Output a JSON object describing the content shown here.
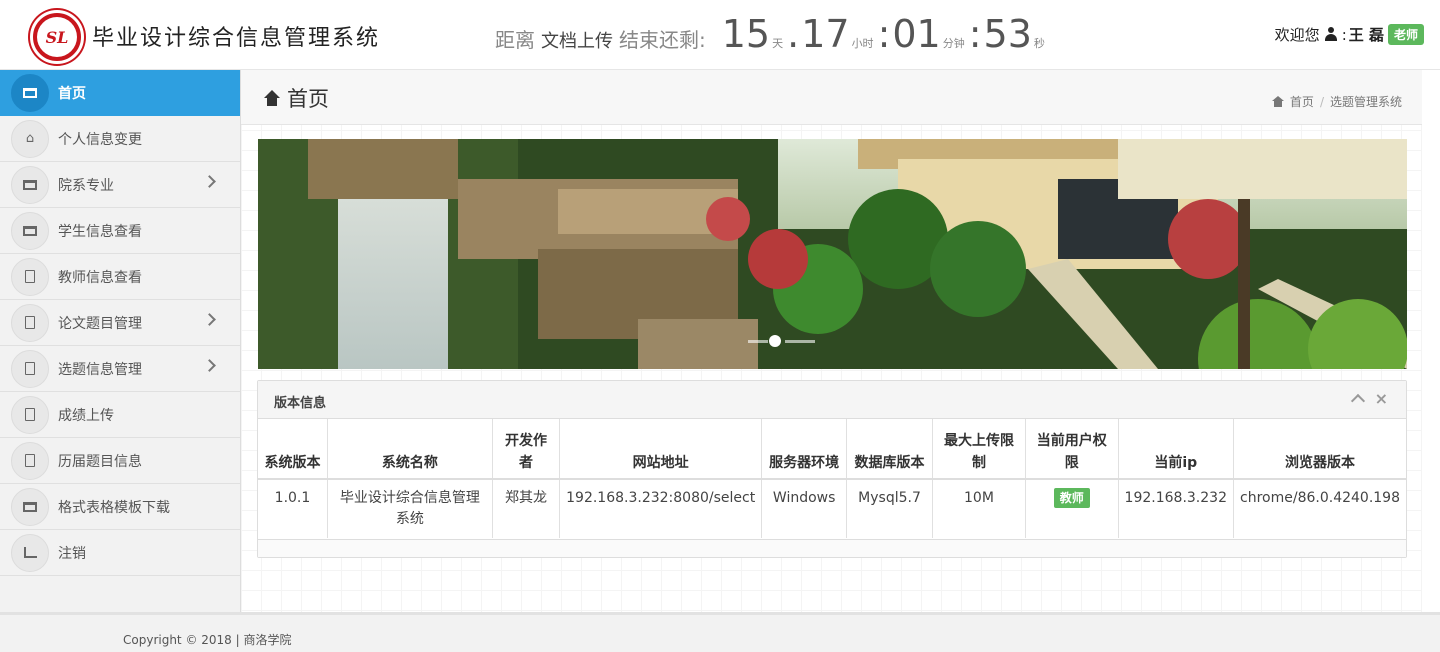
{
  "header": {
    "logo_text": "SL",
    "title": "毕业设计综合信息管理系统",
    "countdown": {
      "prefix": "距离",
      "doc": "文档上传",
      "suffix": "结束还剩:",
      "days": "15",
      "days_unit": "天",
      "hours": "17",
      "hours_unit": "小时",
      "minutes": "01",
      "minutes_unit": "分钟",
      "seconds": "53",
      "seconds_unit": "秒",
      "sep_dot": ".",
      "sep_colon": ":"
    },
    "welcome": "欢迎您",
    "colon": ":",
    "username": "王 磊",
    "role_badge": "老师"
  },
  "sidebar": {
    "items": [
      {
        "label": "首页",
        "icon": "table-icon",
        "active": true
      },
      {
        "label": "个人信息变更",
        "icon": "home-icon"
      },
      {
        "label": "院系专业",
        "icon": "table-icon",
        "submenu": true
      },
      {
        "label": "学生信息查看",
        "icon": "table-icon"
      },
      {
        "label": "教师信息查看",
        "icon": "file-icon"
      },
      {
        "label": "论文题目管理",
        "icon": "file-icon",
        "submenu": true
      },
      {
        "label": "选题信息管理",
        "icon": "file-icon",
        "submenu": true
      },
      {
        "label": "成绩上传",
        "icon": "file-icon"
      },
      {
        "label": "历届题目信息",
        "icon": "file-icon"
      },
      {
        "label": "格式表格模板下载",
        "icon": "table-icon"
      },
      {
        "label": "注销",
        "icon": "chart-icon"
      }
    ]
  },
  "page": {
    "title": "首页",
    "breadcrumb": [
      "首页",
      "选题管理系统"
    ],
    "breadcrumb_sep": "/"
  },
  "panel": {
    "title": "版本信息",
    "headers": [
      "系统版本",
      "系统名称",
      "开发作者",
      "网站地址",
      "服务器环境",
      "数据库版本",
      "最大上传限制",
      "当前用户权限",
      "当前ip",
      "浏览器版本"
    ],
    "row": {
      "version": "1.0.1",
      "name": "毕业设计综合信息管理系统",
      "author": "郑其龙",
      "url": "192.168.3.232:8080/select",
      "server": "Windows",
      "db": "Mysql5.7",
      "max_upload": "10M",
      "permission": "教师",
      "ip": "192.168.3.232",
      "browser": "chrome/86.0.4240.198"
    }
  },
  "footer": {
    "copyright": "Copyright © 2018 | 商洛学院"
  },
  "colors": {
    "accent": "#2e9fe0",
    "badge": "#5cb85c",
    "logo": "#c8161d"
  }
}
